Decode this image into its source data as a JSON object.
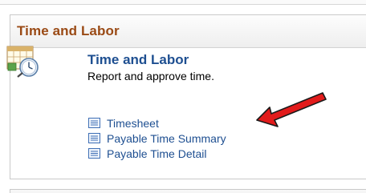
{
  "pagelet": {
    "title": "Time and Labor"
  },
  "group": {
    "icon": "timesheet-clock-icon",
    "title": "Time and Labor",
    "description": "Report and approve time."
  },
  "links": [
    {
      "label": "Timesheet",
      "icon": "list-icon"
    },
    {
      "label": "Payable Time Summary",
      "icon": "list-icon"
    },
    {
      "label": "Payable Time Detail",
      "icon": "list-icon"
    }
  ],
  "annotation": {
    "icon": "red-arrow-icon",
    "color": "#e21b1b"
  },
  "colors": {
    "header_title": "#9a4a15",
    "link": "#1e4f91",
    "border": "#c9c9c9"
  }
}
